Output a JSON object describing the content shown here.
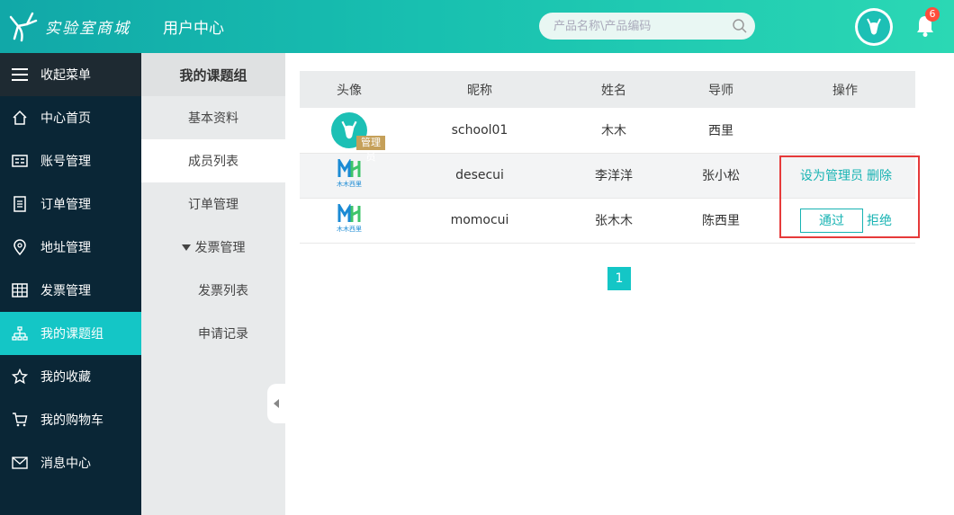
{
  "header": {
    "logo_text": "实验室商城",
    "title": "用户中心",
    "search_placeholder": "产品名称\\产品编码",
    "notification_count": "6"
  },
  "leftnav": {
    "collapse_label": "收起菜单",
    "items": [
      {
        "label": "中心首页",
        "icon": "home-icon"
      },
      {
        "label": "账号管理",
        "icon": "id-card-icon"
      },
      {
        "label": "订单管理",
        "icon": "document-icon"
      },
      {
        "label": "地址管理",
        "icon": "location-pin-icon"
      },
      {
        "label": "发票管理",
        "icon": "grid-icon"
      },
      {
        "label": "我的课题组",
        "icon": "org-chart-icon"
      },
      {
        "label": "我的收藏",
        "icon": "star-icon"
      },
      {
        "label": "我的购物车",
        "icon": "cart-icon"
      },
      {
        "label": "消息中心",
        "icon": "mail-icon"
      }
    ],
    "active": "我的课题组"
  },
  "submenu": {
    "title": "我的课题组",
    "items": [
      "基本资料",
      "成员列表",
      "订单管理",
      "发票管理",
      "发票列表",
      "申请记录"
    ],
    "active": "成员列表"
  },
  "table": {
    "headers": [
      "头像",
      "昵称",
      "姓名",
      "导师",
      "操作"
    ],
    "rows": [
      {
        "nickname": "school01",
        "name": "木木",
        "tutor": "西里",
        "tag": "管理员"
      },
      {
        "nickname": "desecui",
        "name": "李洋洋",
        "tutor": "张小松",
        "op1": "设为管理员",
        "op2": "删除"
      },
      {
        "nickname": "momocui",
        "name": "张木木",
        "tutor": "陈西里",
        "op1": "通过",
        "op2": "拒绝"
      }
    ],
    "brand_logo_text": "木木西里"
  },
  "pagination": {
    "current": "1"
  },
  "colors": {
    "accent": "#14c6c6",
    "nav_bg": "#0a2636",
    "highlight": "#e63a3a",
    "admin_tag": "#c5a059"
  }
}
